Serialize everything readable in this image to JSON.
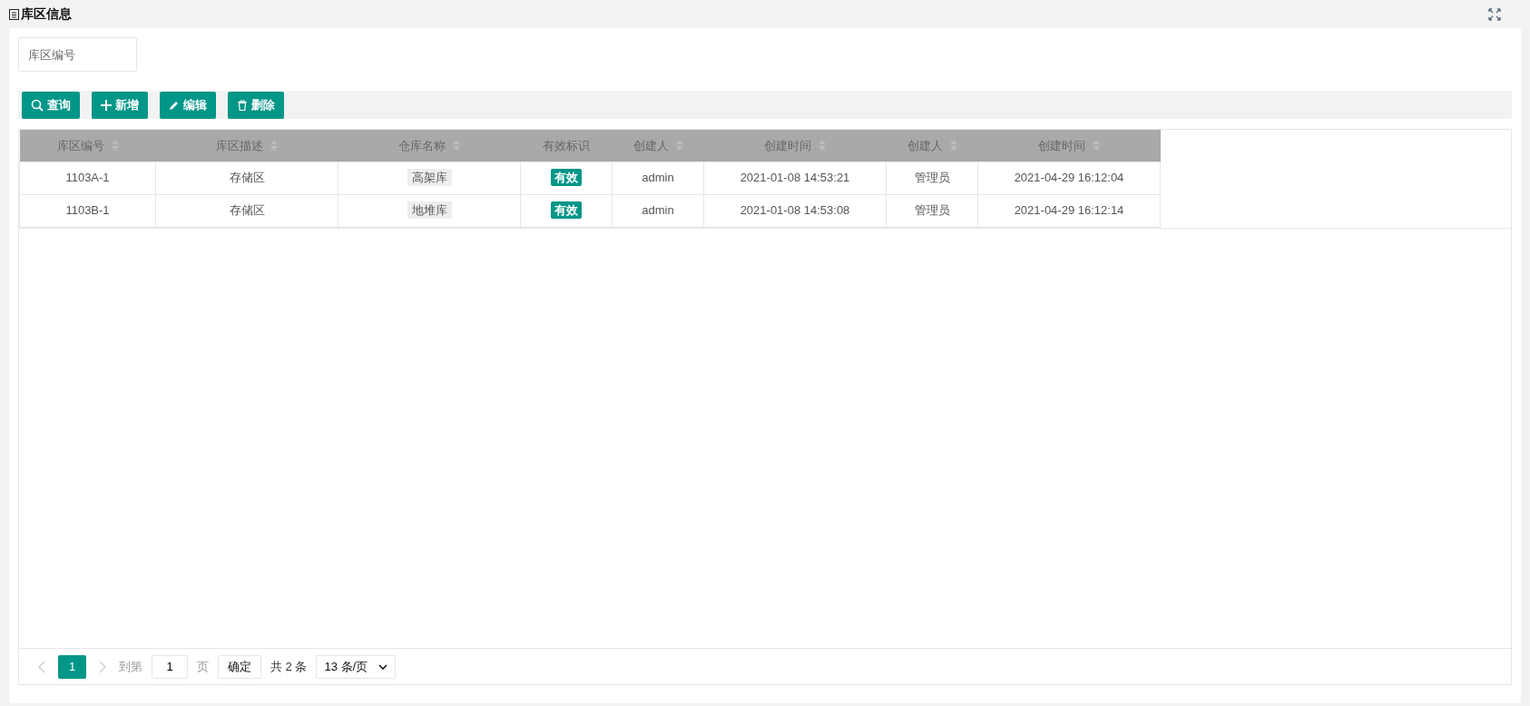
{
  "panel": {
    "title": "库区信息"
  },
  "filter": {
    "placeholder": "库区编号"
  },
  "toolbar": [
    {
      "label": "查询",
      "kind": "search"
    },
    {
      "label": "新增",
      "kind": "add"
    },
    {
      "label": "编辑",
      "kind": "edit"
    },
    {
      "label": "删除",
      "kind": "delete"
    }
  ],
  "table": {
    "columns": [
      {
        "label": "库区编号",
        "sortable": true,
        "kind": "text"
      },
      {
        "label": "库区描述",
        "sortable": true,
        "kind": "text"
      },
      {
        "label": "仓库名称",
        "sortable": true,
        "kind": "tag"
      },
      {
        "label": "有效标识",
        "sortable": false,
        "kind": "badge"
      },
      {
        "label": "创建人",
        "sortable": true,
        "kind": "text"
      },
      {
        "label": "创建时间",
        "sortable": true,
        "kind": "text"
      },
      {
        "label": "创建人",
        "sortable": true,
        "kind": "text"
      },
      {
        "label": "创建时间",
        "sortable": true,
        "kind": "text"
      }
    ],
    "rows": [
      [
        "1103A-1",
        "存储区",
        "高架库",
        "有效",
        "admin",
        "2021-01-08 14:53:21",
        "管理员",
        "2021-04-29 16:12:04"
      ],
      [
        "1103B-1",
        "存储区",
        "地堆库",
        "有效",
        "admin",
        "2021-01-08 14:53:08",
        "管理员",
        "2021-04-29 16:12:14"
      ]
    ]
  },
  "pagination": {
    "pages": [
      {
        "label": "1",
        "selected": true
      }
    ],
    "goto_label": "到第",
    "goto_value": "1",
    "page_unit": "页",
    "confirm": "确定",
    "total": "共 2 条",
    "page_size": "13 条/页"
  }
}
